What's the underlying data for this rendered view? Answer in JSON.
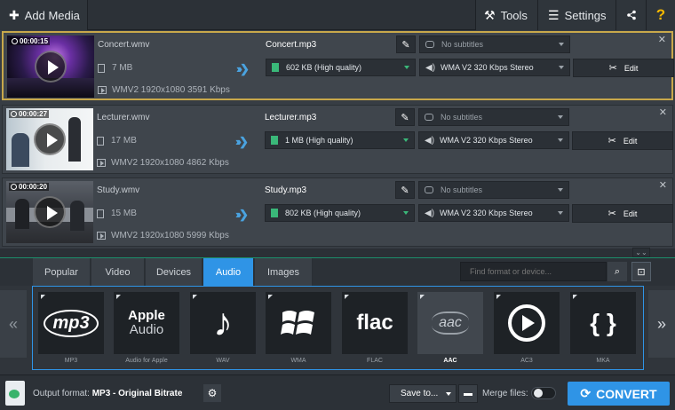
{
  "toolbar": {
    "add_media": "Add Media",
    "tools": "Tools",
    "settings": "Settings",
    "help": "?"
  },
  "media_items": [
    {
      "duration": "00:00:15",
      "source_name": "Concert.wmv",
      "source_size": "7 MB",
      "source_info": "WMV2 1920x1080 3591 Kbps",
      "output_name": "Concert.mp3",
      "output_size": "602 KB (High quality)",
      "subtitles": "No subtitles",
      "audio": "WMA V2 320 Kbps Stereo",
      "edit": "Edit",
      "selected": true
    },
    {
      "duration": "00:00:27",
      "source_name": "Lecturer.wmv",
      "source_size": "17 MB",
      "source_info": "WMV2 1920x1080 4862 Kbps",
      "output_name": "Lecturer.mp3",
      "output_size": "1 MB (High quality)",
      "subtitles": "No subtitles",
      "audio": "WMA V2 320 Kbps Stereo",
      "edit": "Edit",
      "selected": false
    },
    {
      "duration": "00:00:20",
      "source_name": "Study.wmv",
      "source_size": "15 MB",
      "source_info": "WMV2 1920x1080 5999 Kbps",
      "output_name": "Study.mp3",
      "output_size": "802 KB (High quality)",
      "subtitles": "No subtitles",
      "audio": "WMA V2 320 Kbps Stereo",
      "edit": "Edit",
      "selected": false
    }
  ],
  "categories": {
    "tabs": [
      "Popular",
      "Video",
      "Devices",
      "Audio",
      "Images"
    ],
    "active": "Audio",
    "search_placeholder": "Find format or device..."
  },
  "formats": [
    {
      "label": "MP3",
      "glyph": "mp3"
    },
    {
      "label": "Audio for Apple",
      "glyph_line1": "Apple",
      "glyph_line2": "Audio"
    },
    {
      "label": "WAV",
      "glyph": "♪"
    },
    {
      "label": "WMA",
      "glyph": "windows-logo"
    },
    {
      "label": "FLAC",
      "glyph": "flac"
    },
    {
      "label": "AAC",
      "glyph": "aac"
    },
    {
      "label": "AC3",
      "glyph": "play-circle"
    },
    {
      "label": "MKA",
      "glyph": "{ }"
    }
  ],
  "selected_format": "AAC",
  "bottom": {
    "output_label": "Output format:",
    "output_value": "MP3 - Original Bitrate",
    "save_to": "Save to...",
    "merge_label": "Merge files:",
    "merge_on": false,
    "convert": "CONVERT"
  },
  "colors": {
    "accent": "#2f94e6",
    "selected_border": "#c8a84b",
    "size_icon": "#3ab879"
  }
}
